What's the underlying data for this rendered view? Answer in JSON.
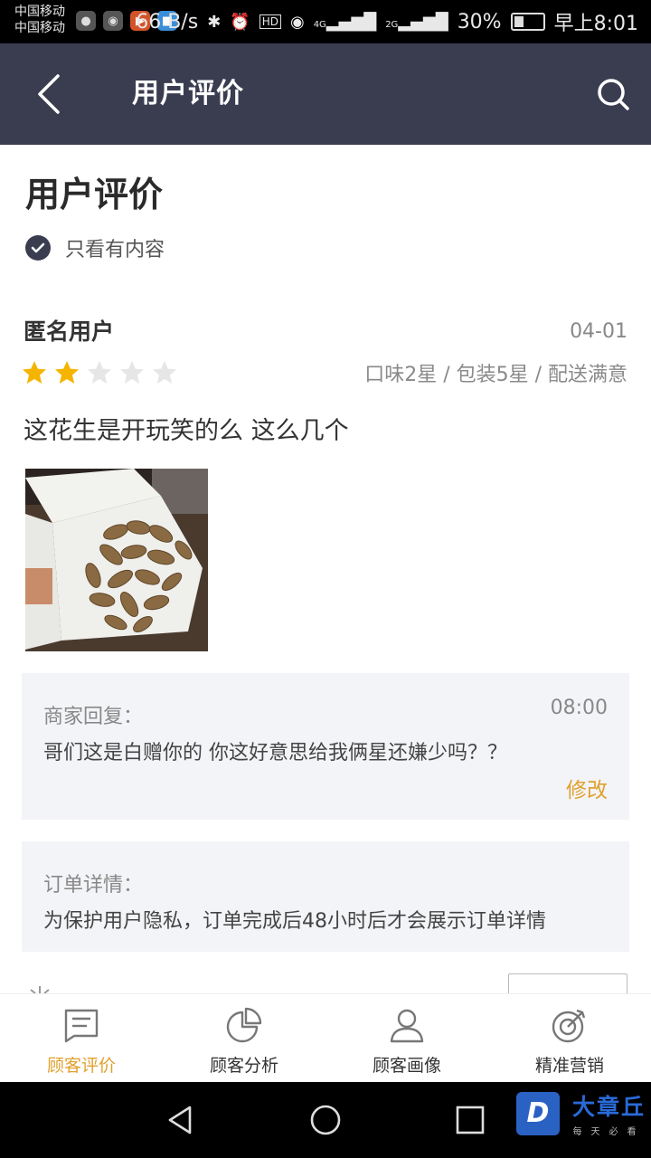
{
  "status_bar": {
    "carrier_1": "中国移动",
    "carrier_2": "中国移动",
    "net_speed": "66 B/s",
    "hd": "HD",
    "sig_4g": "4G",
    "sig_2g": "2G",
    "battery": "30%",
    "time": "早上8:01"
  },
  "header": {
    "title": "用户评价"
  },
  "page": {
    "title": "用户评价",
    "filter_label": "只看有内容"
  },
  "review": {
    "user": "匿名用户",
    "date": "04-01",
    "rating": 2,
    "rating_max": 5,
    "detail": "口味2星 / 包装5星 / 配送满意",
    "text": "这花生是开玩笑的么 这么几个"
  },
  "reply": {
    "label": "商家回复：",
    "time": "08:00",
    "text": "哥们这是白赠你的  你这好意思给我俩星还嫌少吗？？",
    "edit": "修改"
  },
  "order": {
    "label": "订单详情：",
    "text": "为保护用户隐私，订单完成后48小时后才会展示订单详情"
  },
  "bottom_nav": [
    {
      "label": "顾客评价",
      "active": true
    },
    {
      "label": "顾客分析",
      "active": false
    },
    {
      "label": "顾客画像",
      "active": false
    },
    {
      "label": "精准营销",
      "active": false
    }
  ],
  "watermark": {
    "logo": "D",
    "title": "大章丘",
    "sub": "每天必看"
  },
  "colors": {
    "header": "#3a3d50",
    "accent": "#e0a12e",
    "star": "#f5b400"
  }
}
